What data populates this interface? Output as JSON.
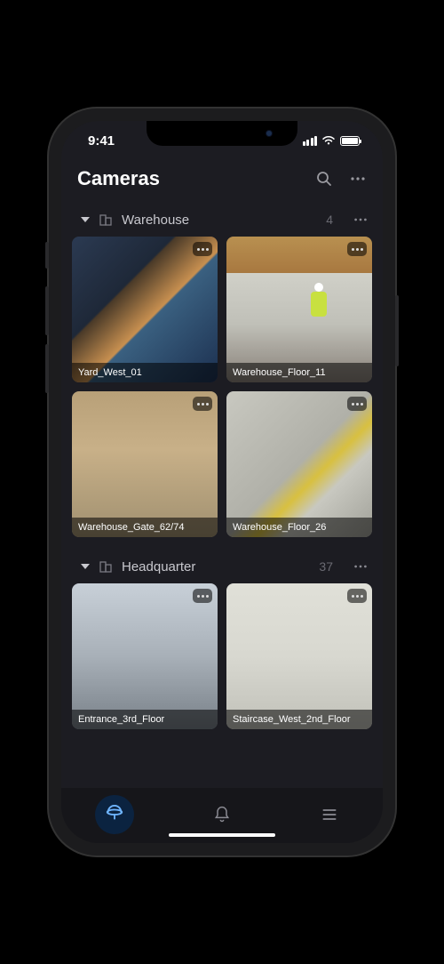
{
  "status": {
    "time": "9:41"
  },
  "header": {
    "title": "Cameras"
  },
  "groups": [
    {
      "name": "Warehouse",
      "count": "4",
      "tiles": [
        {
          "label": "Yard_West_01"
        },
        {
          "label": "Warehouse_Floor_11"
        },
        {
          "label": "Warehouse_Gate_62/74"
        },
        {
          "label": "Warehouse_Floor_26"
        }
      ]
    },
    {
      "name": "Headquarter",
      "count": "37",
      "tiles": [
        {
          "label": "Entrance_3rd_Floor"
        },
        {
          "label": "Staircase_West_2nd_Floor"
        }
      ]
    }
  ],
  "tabs": {
    "cameras": "cameras",
    "notifications": "notifications",
    "menu": "menu"
  }
}
